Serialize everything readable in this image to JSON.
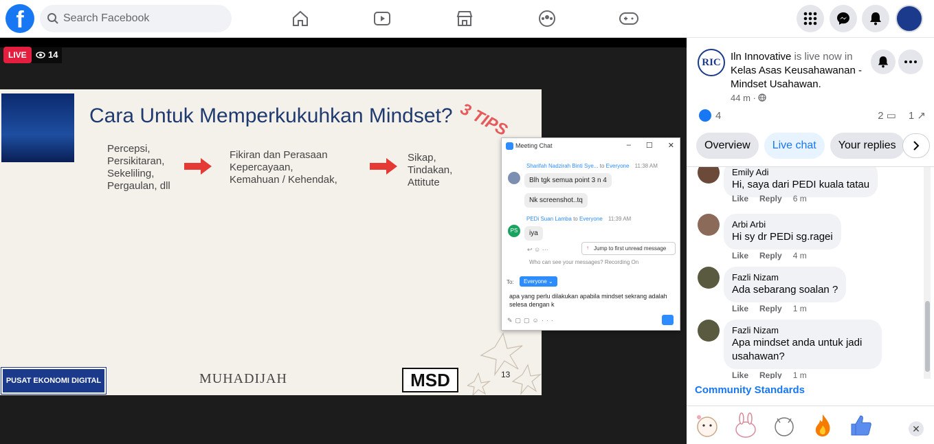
{
  "topbar": {
    "logo": "f",
    "search_placeholder": "Search Facebook",
    "nav_icons": [
      "home-icon",
      "watch-icon",
      "marketplace-icon",
      "groups-icon",
      "gaming-icon"
    ],
    "right_icons": [
      "menu-grid-icon",
      "messenger-icon",
      "notifications-icon"
    ]
  },
  "video": {
    "live_label": "LIVE",
    "viewer_count": "14",
    "slide": {
      "title": "Cara Untuk Memperkukuhkan Mindset?",
      "tips": "3 TIPS",
      "col1": "Percepsi,\nPersikitaran,\nSekeliling,\nPergaulan, dll",
      "col2": "Fikiran dan Perasaan\nKepercayaan,\nKemahuan / Kehendak,",
      "col3": "Sikap,\nTindakan,\nAttitute",
      "footer_left": "PUSAT EKONOMI DIGITAL",
      "footer_mid": "MUHADIJAH",
      "footer_logo": "MSD",
      "page": "13"
    },
    "meeting_chat": {
      "title": "Meeting Chat",
      "msg1_sender": "Sharifah Nadzirah Binti Sye...",
      "msg1_to": "to",
      "msg1_target": "Everyone",
      "msg1_time": "11:38 AM",
      "msg1_text1": "Blh tgk semua point 3 n 4",
      "msg1_text2": "Nk screenshot..tq",
      "msg2_initials": "PS",
      "msg2_sender": "PEDi Suan Lamba",
      "msg2_to": "to",
      "msg2_target": "Everyone",
      "msg2_time": "11:39 AM",
      "msg2_text": "iya",
      "jump_label": "Jump to first unread message",
      "who_can_see": "Who can see your messages? Recording On",
      "to_label": "To:",
      "to_value": "Everyone",
      "compose_text": "apa yang perlu dilakukan apabila mindset sekrang adalah selesa dengan k"
    }
  },
  "sidebar": {
    "page_initials": "RIC",
    "page_name": "Iln Innovative",
    "live_text": " is live now in ",
    "group_name": "Kelas Asas Keusahawanan - Mindset Usahawan",
    "period": ".",
    "post_time": "44 m · ",
    "reaction_count": "4",
    "comment_count": "2",
    "share_count": "1",
    "tabs": [
      "Overview",
      "Live chat",
      "Your replies"
    ],
    "active_tab": "Live chat",
    "comments": [
      {
        "name": "Emily Adi",
        "text": "Hi, saya dari PEDI kuala tatau",
        "like": "Like",
        "reply": "Reply",
        "time": "6 m"
      },
      {
        "name": "Arbi Arbi",
        "text": "Hi sy dr PEDi sg.ragei",
        "like": "Like",
        "reply": "Reply",
        "time": "4 m"
      },
      {
        "name": "Fazli Nizam",
        "text": "Ada sebarang soalan ?",
        "like": "Like",
        "reply": "Reply",
        "time": "1 m"
      },
      {
        "name": "Fazli Nizam",
        "text": "Apa mindset anda untuk jadi usahawan?",
        "like": "Like",
        "reply": "Reply",
        "time": "1 m"
      }
    ],
    "community_standards": "Community Standards",
    "stickers": [
      "cat-hearts-sticker",
      "bunny-sticker",
      "cat-thumbs-sticker",
      "fire-emoji",
      "thumbs-up-emoji"
    ]
  },
  "colors": {
    "brand": "#1877f2",
    "live": "#e41e3f",
    "zoom": "#2d8cff"
  }
}
